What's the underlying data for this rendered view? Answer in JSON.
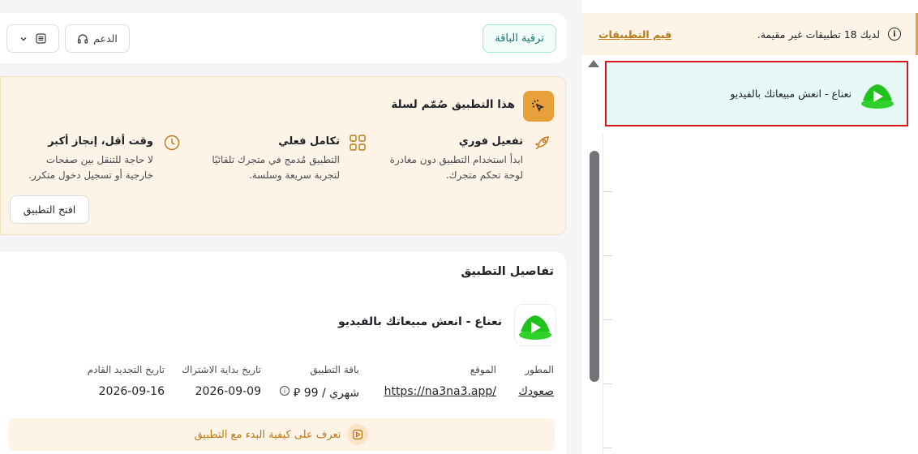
{
  "notice": {
    "text": "لديك 18 تطبيقات غير مقيمة.",
    "link": "قيم التطبيقات"
  },
  "sidebar_app": {
    "name": "نعناع - انعش مبيعاتك بالفيديو"
  },
  "topbar": {
    "upgrade_label": "ترقية الباقة",
    "support_label": "الدعم"
  },
  "promo": {
    "title": "هذا التطبيق صُمّم لسلة",
    "features": [
      {
        "title": "تفعيل فوري",
        "desc_line1": "ابدأ استخدام التطبيق دون مغادرة",
        "desc_line2": "لوحة تحكم متجرك."
      },
      {
        "title": "تكامل فعلي",
        "desc_line1": "التطبيق مُدمج في متجرك تلقائيًا",
        "desc_line2": "لتجربة سريعة وسلسة."
      },
      {
        "title": "وقت أقل، إنجاز أكبر",
        "desc_line1": "لا حاجة للتنقل بين صفحات",
        "desc_line2": "خارجية أو تسجيل دخول متكرر."
      }
    ],
    "open_label": "افتح التطبيق"
  },
  "details": {
    "title": "تفاصيل التطبيق",
    "app_name": "نعناع - انعش مبيعاتك بالفيديو",
    "meta": [
      {
        "label": "المطور",
        "value": "صعودك"
      },
      {
        "label": "الموقع",
        "value": "https://na3na3.app/"
      },
      {
        "label": "باقة التطبيق",
        "value": "شهري / 99 ⃁"
      },
      {
        "label": "تاريخ بداية الاشتراك",
        "value": "2026-09-09"
      },
      {
        "label": "تاريخ التجديد القادم",
        "value": "2026-09-16"
      }
    ],
    "guide": "تعرف على كيفية البدء مع التطبيق"
  },
  "colors": {
    "accent_orange": "#e8a13a",
    "accent_teal": "#0f766e",
    "highlight_red": "#d9161d",
    "logo_green": "#22c21d"
  }
}
